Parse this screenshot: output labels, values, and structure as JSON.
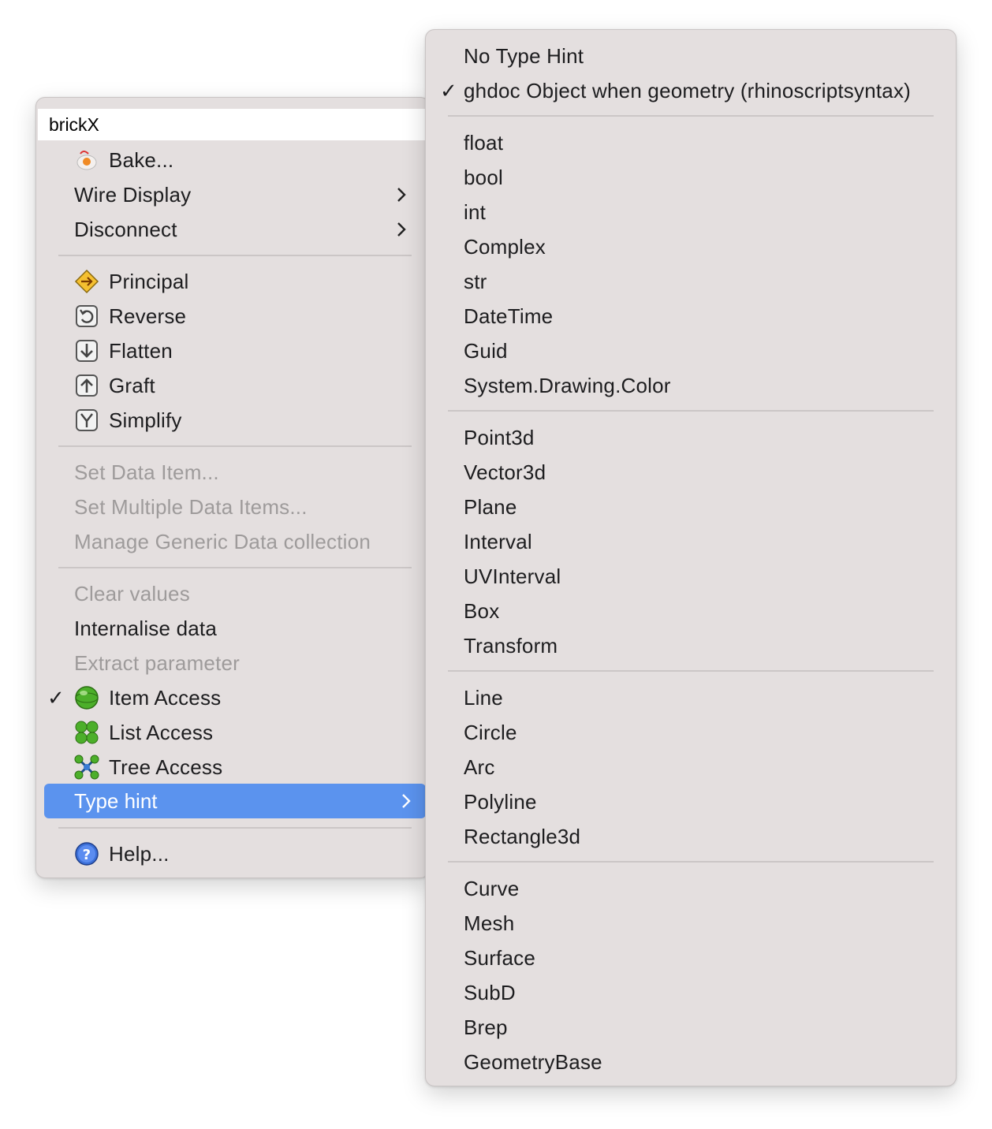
{
  "main_menu": {
    "name_field_value": "brickX",
    "bake": "Bake...",
    "wire_display": "Wire Display",
    "disconnect": "Disconnect",
    "principal": "Principal",
    "reverse": "Reverse",
    "flatten": "Flatten",
    "graft": "Graft",
    "simplify": "Simplify",
    "set_data_item": "Set Data Item...",
    "set_multiple": "Set Multiple Data Items...",
    "manage_generic": "Manage Generic Data collection",
    "clear_values": "Clear values",
    "internalise": "Internalise data",
    "extract": "Extract parameter",
    "item_access": "Item Access",
    "list_access": "List Access",
    "tree_access": "Tree Access",
    "type_hint": "Type hint",
    "help": "Help...",
    "checkmark": "✓"
  },
  "type_hint_menu": {
    "group1": [
      "No Type Hint",
      "ghdoc Object when geometry (rhinoscriptsyntax)"
    ],
    "group2": [
      "float",
      "bool",
      "int",
      "Complex",
      "str",
      "DateTime",
      "Guid",
      "System.Drawing.Color"
    ],
    "group3": [
      "Point3d",
      "Vector3d",
      "Plane",
      "Interval",
      "UVInterval",
      "Box",
      "Transform"
    ],
    "group4": [
      "Line",
      "Circle",
      "Arc",
      "Polyline",
      "Rectangle3d"
    ],
    "group5": [
      "Curve",
      "Mesh",
      "Surface",
      "SubD",
      "Brep",
      "GeometryBase"
    ],
    "checkmark": "✓"
  },
  "colors": {
    "menu_bg": "#e4dfdf",
    "highlight": "#5b93ee",
    "disabled_text": "#9e9b9b"
  }
}
